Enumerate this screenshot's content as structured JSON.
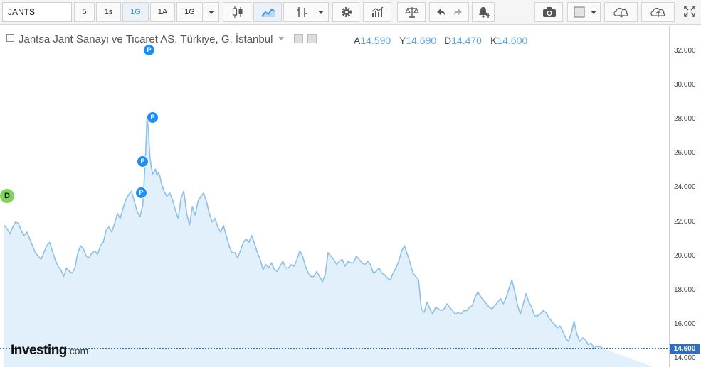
{
  "toolbar": {
    "symbol": "JANTS",
    "intervals": [
      "5",
      "1s",
      "1G",
      "1A",
      "1G"
    ],
    "active_interval_index": 2
  },
  "legend": {
    "title": "Jantsa Jant Sanayi ve Ticaret AS, Türkiye, G, İstanbul",
    "open_label": "A",
    "open_value": "14.590",
    "high_label": "Y",
    "high_value": "14.690",
    "low_label": "D",
    "low_value": "14.470",
    "close_label": "K",
    "close_value": "14.600"
  },
  "last_price_label": "14.600",
  "branding": {
    "logo": "Investing",
    "logo_suffix": ".com"
  },
  "markers": {
    "dividend_label": "D",
    "split_label": "P"
  },
  "colors": {
    "line": "#8ec0e6",
    "area": "#e1f0fa",
    "accent": "#3d8fd6",
    "badge": "#2d6ec7",
    "marker": "#1e8ff0",
    "dividend": "#7fd45a"
  },
  "chart_data": {
    "type": "area",
    "ylim": [
      13.5,
      33.5
    ],
    "y_ticks": [
      14,
      16,
      18,
      20,
      22,
      24,
      26,
      28,
      30,
      32
    ],
    "y_tick_labels": [
      "14.000",
      "16.000",
      "18.000",
      "20.000",
      "22.000",
      "24.000",
      "26.000",
      "28.000",
      "30.000",
      "32.000"
    ],
    "last_value": 14.6,
    "x": [
      0,
      4,
      8,
      12,
      16,
      20,
      24,
      28,
      32,
      36,
      40,
      44,
      48,
      52,
      56,
      60,
      64,
      68,
      72,
      76,
      80,
      84,
      88,
      92,
      96,
      100,
      104,
      108,
      112,
      116,
      120,
      124,
      128,
      132,
      136,
      140,
      144,
      148,
      152,
      156,
      160,
      164,
      168,
      172,
      176,
      180,
      184,
      188,
      192,
      196,
      198,
      200,
      202,
      204,
      206,
      208,
      210,
      212,
      214,
      216,
      218,
      220,
      222,
      226,
      230,
      234,
      238,
      242,
      246,
      250,
      254,
      258,
      262,
      266,
      270,
      274,
      278,
      282,
      286,
      290,
      294,
      298,
      302,
      306,
      310,
      314,
      318,
      322,
      326,
      330,
      334,
      338,
      342,
      346,
      350,
      354,
      358,
      362,
      366,
      370,
      374,
      378,
      382,
      386,
      390,
      394,
      398,
      402,
      406,
      410,
      414,
      418,
      422,
      426,
      430,
      434,
      438,
      442,
      446,
      450,
      454,
      458,
      462,
      466,
      470,
      474,
      478,
      482,
      486,
      490,
      494,
      498,
      502,
      506,
      510,
      514,
      518,
      522,
      526,
      530,
      534,
      538,
      542,
      546,
      550,
      554,
      558,
      562,
      566,
      570,
      574,
      578,
      582,
      586,
      590,
      594,
      598,
      602,
      606,
      610,
      614,
      618,
      622,
      626,
      630,
      634,
      638,
      642,
      646,
      650,
      654,
      658,
      662,
      666,
      670,
      674,
      678,
      682,
      686,
      690,
      694,
      698,
      702,
      706,
      710,
      714,
      718,
      722,
      726,
      730,
      734,
      738,
      742,
      746,
      750,
      754,
      758,
      762,
      766,
      770,
      774,
      778,
      782,
      786,
      790,
      794,
      798,
      802,
      806,
      810,
      814,
      818,
      822,
      826,
      830,
      834,
      838,
      842,
      846,
      850,
      854,
      858,
      862,
      866,
      870,
      874,
      878,
      882,
      886,
      890,
      894,
      898,
      902,
      906,
      910,
      914,
      918
    ],
    "values": [
      21.8,
      21.6,
      21.3,
      21.7,
      22.0,
      21.9,
      21.5,
      21.2,
      21.4,
      21.0,
      20.6,
      20.2,
      20.0,
      19.8,
      20.2,
      20.6,
      20.8,
      20.3,
      19.8,
      19.4,
      19.2,
      18.8,
      19.3,
      19.1,
      19.0,
      19.3,
      20.2,
      20.6,
      20.4,
      20.0,
      19.9,
      20.2,
      20.3,
      20.1,
      20.6,
      20.8,
      21.5,
      21.7,
      21.4,
      21.9,
      22.5,
      22.2,
      22.8,
      23.3,
      23.6,
      23.8,
      23.2,
      22.6,
      22.3,
      23.0,
      24.5,
      26.0,
      28.3,
      27.2,
      25.8,
      25.2,
      24.8,
      24.9,
      25.1,
      24.7,
      24.9,
      24.7,
      24.3,
      23.8,
      23.5,
      23.7,
      23.3,
      22.7,
      22.2,
      23.4,
      23.8,
      22.5,
      21.8,
      22.9,
      22.4,
      23.2,
      23.5,
      23.7,
      23.2,
      22.5,
      22.0,
      22.2,
      21.7,
      21.4,
      21.8,
      21.2,
      20.6,
      20.2,
      20.2,
      19.9,
      20.3,
      20.8,
      21.0,
      20.8,
      21.2,
      20.7,
      20.2,
      19.8,
      19.2,
      19.5,
      19.3,
      19.6,
      19.2,
      19.1,
      19.4,
      19.7,
      19.3,
      19.3,
      19.5,
      19.4,
      19.8,
      20.3,
      20.0,
      19.4,
      19.0,
      18.8,
      18.8,
      19.1,
      18.8,
      18.5,
      18.9,
      20.2,
      20.0,
      19.8,
      19.5,
      19.7,
      19.8,
      19.4,
      19.7,
      19.6,
      19.6,
      20.0,
      19.8,
      19.6,
      19.5,
      19.7,
      19.5,
      19.0,
      19.1,
      19.3,
      19.0,
      18.9,
      18.7,
      18.6,
      19.0,
      19.3,
      19.7,
      20.3,
      20.6,
      20.1,
      19.6,
      19.0,
      18.8,
      18.6,
      16.9,
      16.7,
      17.3,
      16.9,
      16.6,
      17.0,
      16.9,
      16.8,
      16.9,
      17.2,
      17.0,
      16.8,
      16.6,
      16.7,
      16.6,
      16.8,
      16.8,
      17.0,
      17.1,
      17.6,
      17.9,
      17.6,
      17.4,
      17.2,
      17.0,
      16.9,
      17.1,
      17.3,
      17.5,
      17.2,
      17.6,
      18.1,
      18.6,
      17.9,
      17.1,
      16.6,
      17.2,
      17.8,
      17.3,
      17.0,
      16.5,
      16.5,
      16.6,
      16.8,
      16.7,
      16.4,
      16.2,
      16.0,
      15.8,
      15.9,
      15.6,
      15.2,
      15.0,
      15.5,
      16.2,
      15.4,
      15.0,
      15.2,
      15.1,
      14.8,
      14.9,
      14.6,
      14.7,
      14.7,
      14.6
    ]
  }
}
